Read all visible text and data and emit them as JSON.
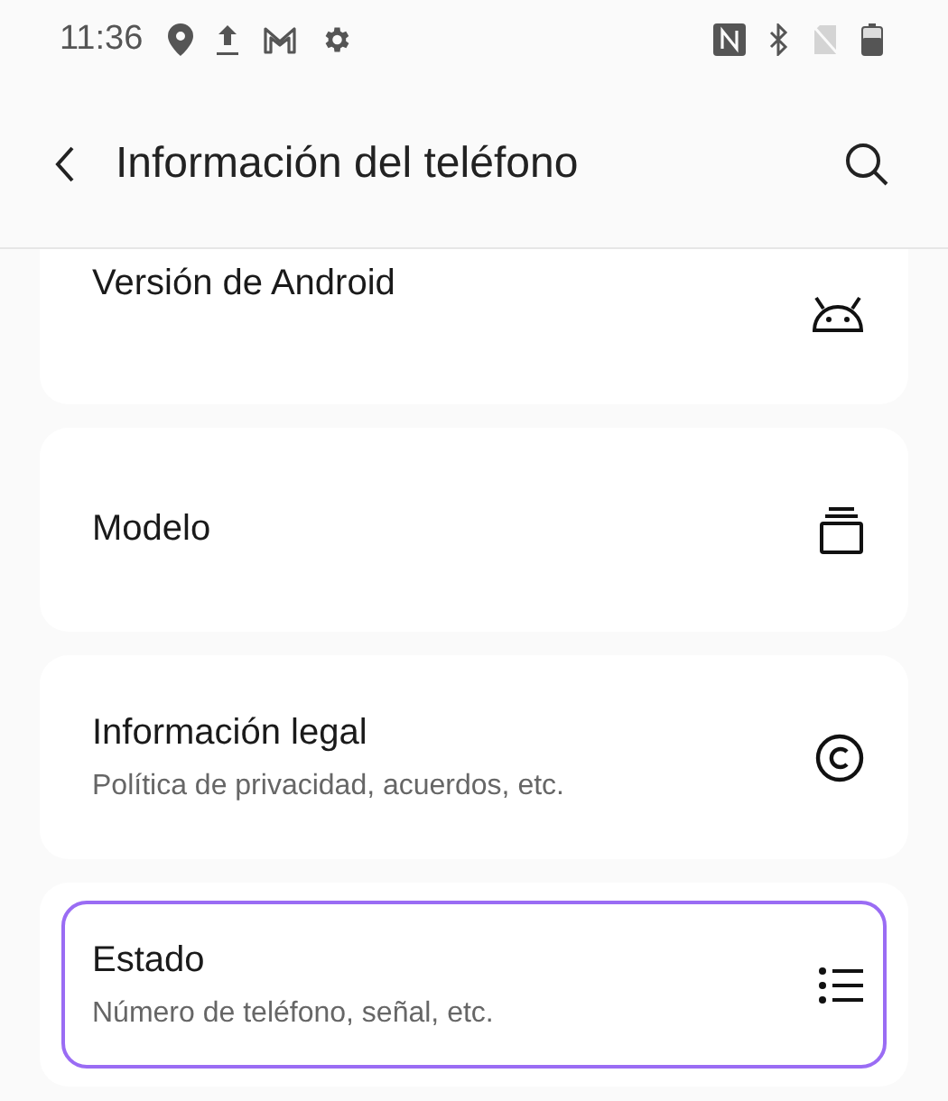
{
  "status_bar": {
    "time": "11:36"
  },
  "header": {
    "title": "Información del teléfono"
  },
  "items": [
    {
      "kind": "android",
      "title": "Versión de Android",
      "selected": false,
      "cut": true
    },
    {
      "kind": "stack",
      "title": "Modelo",
      "selected": false
    },
    {
      "kind": "copyright",
      "title": "Información legal",
      "subtitle": "Política de privacidad, acuerdos, etc.",
      "selected": false
    },
    {
      "kind": "list",
      "title": "Estado",
      "subtitle": "Número de teléfono, señal, etc.",
      "selected": true
    }
  ]
}
